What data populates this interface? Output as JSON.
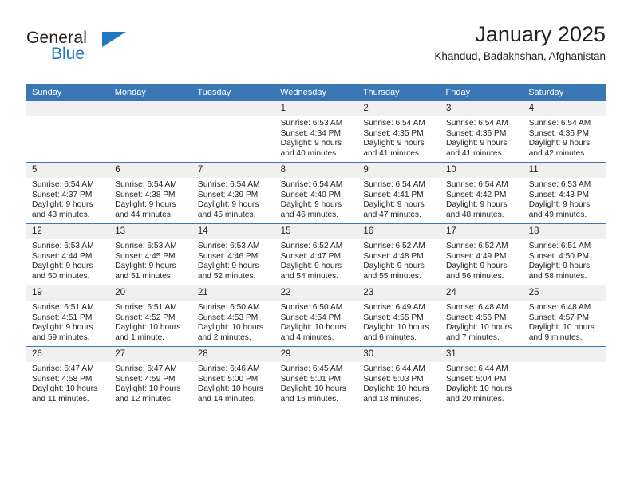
{
  "brand": {
    "name_top": "General",
    "name_bottom": "Blue",
    "triangle_icon": "blue-triangle-logo-mark",
    "accent_color": "#1f78c1"
  },
  "header": {
    "title": "January 2025",
    "subtitle": "Khandud, Badakhshan, Afghanistan"
  },
  "theme": {
    "header_row_bg": "#3a78b5",
    "daynum_bg": "#f0f0f0",
    "text_color": "#231f20",
    "cell_border": "#d2d2d2"
  },
  "weekday_headers": [
    "Sunday",
    "Monday",
    "Tuesday",
    "Wednesday",
    "Thursday",
    "Friday",
    "Saturday"
  ],
  "labels": {
    "sunrise_prefix": "Sunrise:",
    "sunset_prefix": "Sunset:",
    "daylight_prefix": "Daylight:"
  },
  "weeks": [
    [
      {
        "day": "",
        "empty": true
      },
      {
        "day": "",
        "empty": true
      },
      {
        "day": "",
        "empty": true
      },
      {
        "day": "1",
        "sunrise": "Sunrise: 6:53 AM",
        "sunset": "Sunset: 4:34 PM",
        "daylight_line1": "Daylight: 9 hours",
        "daylight_line2": "and 40 minutes."
      },
      {
        "day": "2",
        "sunrise": "Sunrise: 6:54 AM",
        "sunset": "Sunset: 4:35 PM",
        "daylight_line1": "Daylight: 9 hours",
        "daylight_line2": "and 41 minutes."
      },
      {
        "day": "3",
        "sunrise": "Sunrise: 6:54 AM",
        "sunset": "Sunset: 4:36 PM",
        "daylight_line1": "Daylight: 9 hours",
        "daylight_line2": "and 41 minutes."
      },
      {
        "day": "4",
        "sunrise": "Sunrise: 6:54 AM",
        "sunset": "Sunset: 4:36 PM",
        "daylight_line1": "Daylight: 9 hours",
        "daylight_line2": "and 42 minutes."
      }
    ],
    [
      {
        "day": "5",
        "sunrise": "Sunrise: 6:54 AM",
        "sunset": "Sunset: 4:37 PM",
        "daylight_line1": "Daylight: 9 hours",
        "daylight_line2": "and 43 minutes."
      },
      {
        "day": "6",
        "sunrise": "Sunrise: 6:54 AM",
        "sunset": "Sunset: 4:38 PM",
        "daylight_line1": "Daylight: 9 hours",
        "daylight_line2": "and 44 minutes."
      },
      {
        "day": "7",
        "sunrise": "Sunrise: 6:54 AM",
        "sunset": "Sunset: 4:39 PM",
        "daylight_line1": "Daylight: 9 hours",
        "daylight_line2": "and 45 minutes."
      },
      {
        "day": "8",
        "sunrise": "Sunrise: 6:54 AM",
        "sunset": "Sunset: 4:40 PM",
        "daylight_line1": "Daylight: 9 hours",
        "daylight_line2": "and 46 minutes."
      },
      {
        "day": "9",
        "sunrise": "Sunrise: 6:54 AM",
        "sunset": "Sunset: 4:41 PM",
        "daylight_line1": "Daylight: 9 hours",
        "daylight_line2": "and 47 minutes."
      },
      {
        "day": "10",
        "sunrise": "Sunrise: 6:54 AM",
        "sunset": "Sunset: 4:42 PM",
        "daylight_line1": "Daylight: 9 hours",
        "daylight_line2": "and 48 minutes."
      },
      {
        "day": "11",
        "sunrise": "Sunrise: 6:53 AM",
        "sunset": "Sunset: 4:43 PM",
        "daylight_line1": "Daylight: 9 hours",
        "daylight_line2": "and 49 minutes."
      }
    ],
    [
      {
        "day": "12",
        "sunrise": "Sunrise: 6:53 AM",
        "sunset": "Sunset: 4:44 PM",
        "daylight_line1": "Daylight: 9 hours",
        "daylight_line2": "and 50 minutes."
      },
      {
        "day": "13",
        "sunrise": "Sunrise: 6:53 AM",
        "sunset": "Sunset: 4:45 PM",
        "daylight_line1": "Daylight: 9 hours",
        "daylight_line2": "and 51 minutes."
      },
      {
        "day": "14",
        "sunrise": "Sunrise: 6:53 AM",
        "sunset": "Sunset: 4:46 PM",
        "daylight_line1": "Daylight: 9 hours",
        "daylight_line2": "and 52 minutes."
      },
      {
        "day": "15",
        "sunrise": "Sunrise: 6:52 AM",
        "sunset": "Sunset: 4:47 PM",
        "daylight_line1": "Daylight: 9 hours",
        "daylight_line2": "and 54 minutes."
      },
      {
        "day": "16",
        "sunrise": "Sunrise: 6:52 AM",
        "sunset": "Sunset: 4:48 PM",
        "daylight_line1": "Daylight: 9 hours",
        "daylight_line2": "and 55 minutes."
      },
      {
        "day": "17",
        "sunrise": "Sunrise: 6:52 AM",
        "sunset": "Sunset: 4:49 PM",
        "daylight_line1": "Daylight: 9 hours",
        "daylight_line2": "and 56 minutes."
      },
      {
        "day": "18",
        "sunrise": "Sunrise: 6:51 AM",
        "sunset": "Sunset: 4:50 PM",
        "daylight_line1": "Daylight: 9 hours",
        "daylight_line2": "and 58 minutes."
      }
    ],
    [
      {
        "day": "19",
        "sunrise": "Sunrise: 6:51 AM",
        "sunset": "Sunset: 4:51 PM",
        "daylight_line1": "Daylight: 9 hours",
        "daylight_line2": "and 59 minutes."
      },
      {
        "day": "20",
        "sunrise": "Sunrise: 6:51 AM",
        "sunset": "Sunset: 4:52 PM",
        "daylight_line1": "Daylight: 10 hours",
        "daylight_line2": "and 1 minute."
      },
      {
        "day": "21",
        "sunrise": "Sunrise: 6:50 AM",
        "sunset": "Sunset: 4:53 PM",
        "daylight_line1": "Daylight: 10 hours",
        "daylight_line2": "and 2 minutes."
      },
      {
        "day": "22",
        "sunrise": "Sunrise: 6:50 AM",
        "sunset": "Sunset: 4:54 PM",
        "daylight_line1": "Daylight: 10 hours",
        "daylight_line2": "and 4 minutes."
      },
      {
        "day": "23",
        "sunrise": "Sunrise: 6:49 AM",
        "sunset": "Sunset: 4:55 PM",
        "daylight_line1": "Daylight: 10 hours",
        "daylight_line2": "and 6 minutes."
      },
      {
        "day": "24",
        "sunrise": "Sunrise: 6:48 AM",
        "sunset": "Sunset: 4:56 PM",
        "daylight_line1": "Daylight: 10 hours",
        "daylight_line2": "and 7 minutes."
      },
      {
        "day": "25",
        "sunrise": "Sunrise: 6:48 AM",
        "sunset": "Sunset: 4:57 PM",
        "daylight_line1": "Daylight: 10 hours",
        "daylight_line2": "and 9 minutes."
      }
    ],
    [
      {
        "day": "26",
        "sunrise": "Sunrise: 6:47 AM",
        "sunset": "Sunset: 4:58 PM",
        "daylight_line1": "Daylight: 10 hours",
        "daylight_line2": "and 11 minutes."
      },
      {
        "day": "27",
        "sunrise": "Sunrise: 6:47 AM",
        "sunset": "Sunset: 4:59 PM",
        "daylight_line1": "Daylight: 10 hours",
        "daylight_line2": "and 12 minutes."
      },
      {
        "day": "28",
        "sunrise": "Sunrise: 6:46 AM",
        "sunset": "Sunset: 5:00 PM",
        "daylight_line1": "Daylight: 10 hours",
        "daylight_line2": "and 14 minutes."
      },
      {
        "day": "29",
        "sunrise": "Sunrise: 6:45 AM",
        "sunset": "Sunset: 5:01 PM",
        "daylight_line1": "Daylight: 10 hours",
        "daylight_line2": "and 16 minutes."
      },
      {
        "day": "30",
        "sunrise": "Sunrise: 6:44 AM",
        "sunset": "Sunset: 5:03 PM",
        "daylight_line1": "Daylight: 10 hours",
        "daylight_line2": "and 18 minutes."
      },
      {
        "day": "31",
        "sunrise": "Sunrise: 6:44 AM",
        "sunset": "Sunset: 5:04 PM",
        "daylight_line1": "Daylight: 10 hours",
        "daylight_line2": "and 20 minutes."
      },
      {
        "day": "",
        "empty": true
      }
    ]
  ]
}
